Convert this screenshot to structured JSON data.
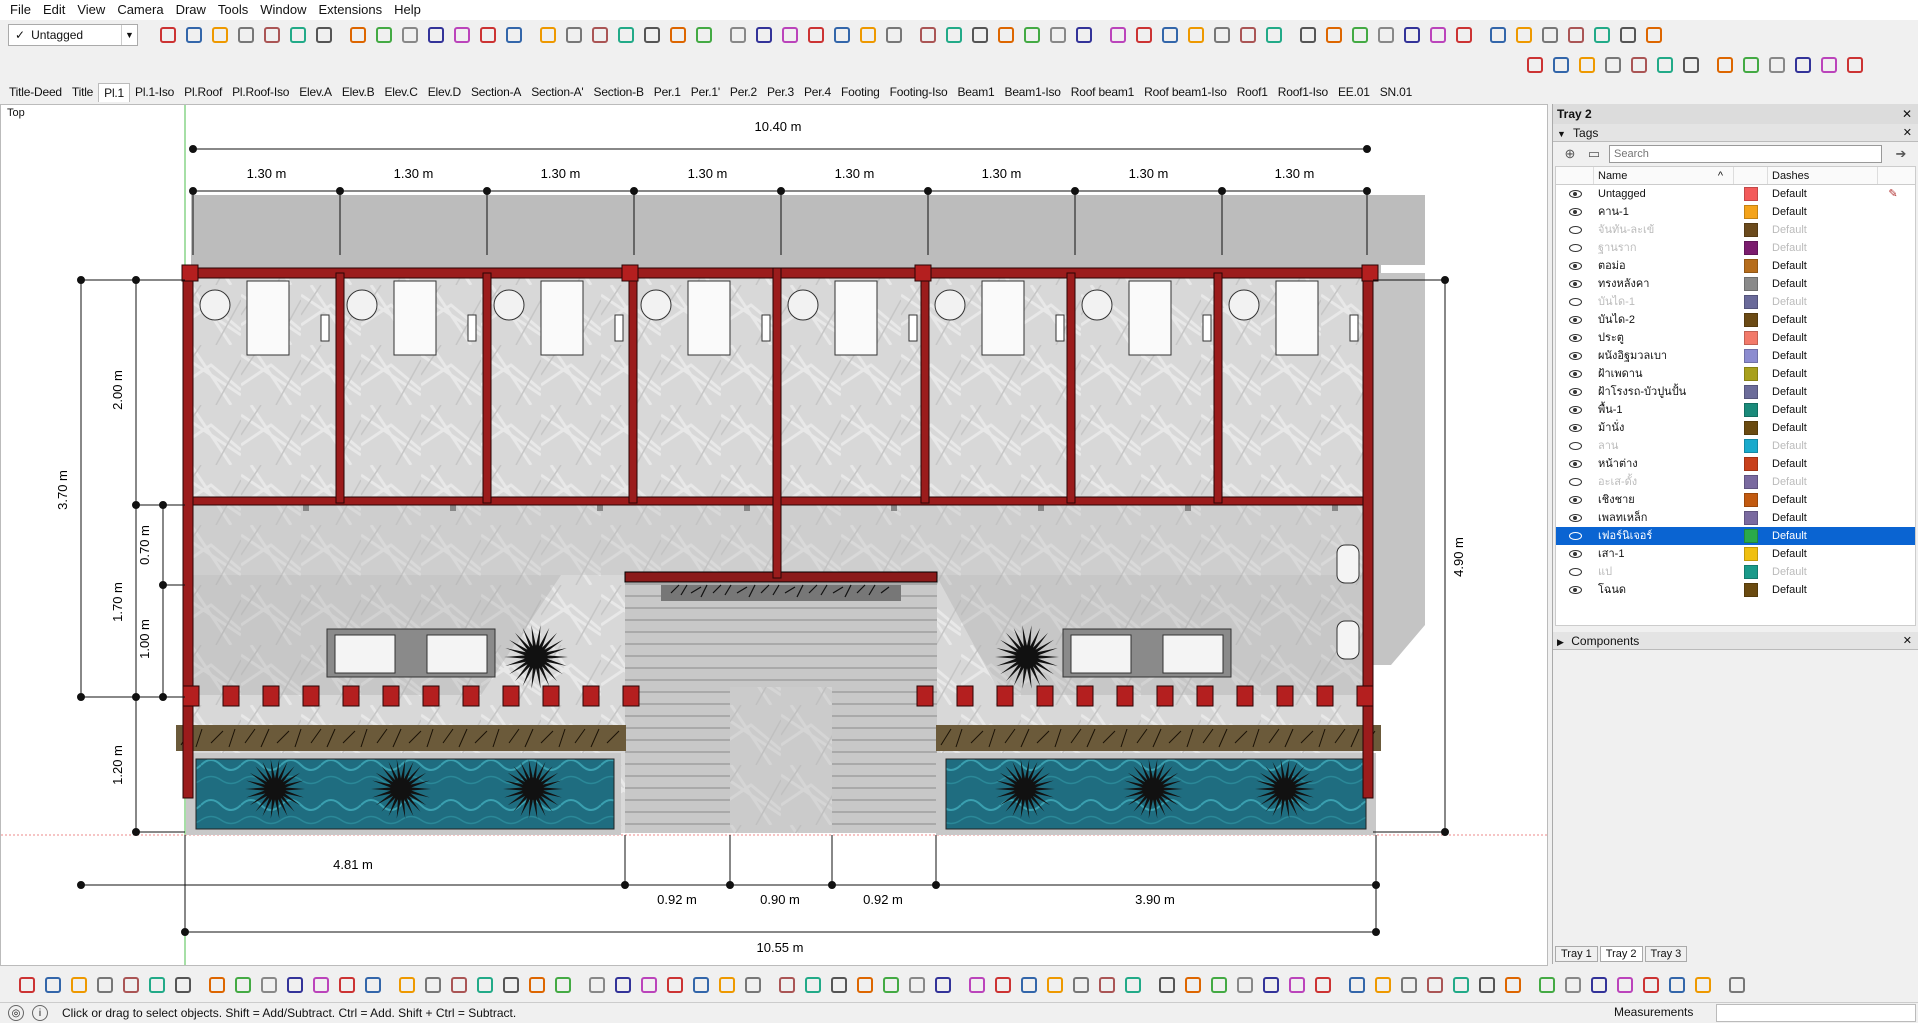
{
  "menu": [
    "File",
    "Edit",
    "View",
    "Camera",
    "Draw",
    "Tools",
    "Window",
    "Extensions",
    "Help"
  ],
  "tag_selector": {
    "check": "✓",
    "value": "Untagged"
  },
  "scene_tabs": {
    "active_index": 2,
    "items": [
      "Title-Deed",
      "Title",
      "Pl.1",
      "Pl.1-Iso",
      "Pl.Roof",
      "Pl.Roof-Iso",
      "Elev.A",
      "Elev.B",
      "Elev.C",
      "Elev.D",
      "Section-A",
      "Section-A'",
      "Section-B",
      "Per.1",
      "Per.1'",
      "Per.2",
      "Per.3",
      "Per.4",
      "Footing",
      "Footing-Iso",
      "Beam1",
      "Beam1-Iso",
      "Roof beam1",
      "Roof beam1-Iso",
      "Roof1",
      "Roof1-Iso",
      "EE.01",
      "SN.01"
    ]
  },
  "viewport": {
    "view_label": "Top",
    "dimensions": {
      "top_total": "10.40 m",
      "bay": "1.30 m",
      "left_total": "3.70 m",
      "left_2": "2.00 m",
      "left_07": "0.70 m",
      "left_17": "1.70 m",
      "left_10": "1.00 m",
      "left_12": "1.20 m",
      "right_total": "4.90 m",
      "bottom_481": "4.81 m",
      "bottom_092a": "0.92 m",
      "bottom_090": "0.90 m",
      "bottom_092b": "0.92 m",
      "bottom_390": "3.90 m",
      "bottom_total": "10.55 m"
    }
  },
  "tray": {
    "title": "Tray 2",
    "tags_panel": "Tags",
    "search_placeholder": "Search",
    "col_name": "Name",
    "col_dashes": "Dashes",
    "rows": [
      {
        "name": "Untagged",
        "color": "#f35a5a",
        "dashes": "Default",
        "visible": true,
        "selected": false,
        "edit": true
      },
      {
        "name": "คาน-1",
        "color": "#f4a31a",
        "dashes": "Default",
        "visible": true,
        "selected": false
      },
      {
        "name": "จันทัน-ละเข้",
        "color": "#6b4a1c",
        "dashes": "Default",
        "visible": false,
        "selected": false
      },
      {
        "name": "ฐานราก",
        "color": "#7b1c6e",
        "dashes": "Default",
        "visible": false,
        "selected": false
      },
      {
        "name": "ตอม่อ",
        "color": "#b66d1c",
        "dashes": "Default",
        "visible": true,
        "selected": false
      },
      {
        "name": "ทรงหลังคา",
        "color": "#8a8a8a",
        "dashes": "Default",
        "visible": true,
        "selected": false
      },
      {
        "name": "บันได-1",
        "color": "#6a6a9a",
        "dashes": "Default",
        "visible": false,
        "selected": false
      },
      {
        "name": "บันได-2",
        "color": "#6b4a14",
        "dashes": "Default",
        "visible": true,
        "selected": false
      },
      {
        "name": "ประตู",
        "color": "#f27a6a",
        "dashes": "Default",
        "visible": true,
        "selected": false
      },
      {
        "name": "ผนังอิฐมวลเบา",
        "color": "#8c8cd0",
        "dashes": "Default",
        "visible": true,
        "selected": false
      },
      {
        "name": "ฝ้าเพดาน",
        "color": "#a8a01c",
        "dashes": "Default",
        "visible": true,
        "selected": false
      },
      {
        "name": "ฝ้าโรงรถ-บัวปูนปั้น",
        "color": "#6c6c9a",
        "dashes": "Default",
        "visible": true,
        "selected": false
      },
      {
        "name": "พื้น-1",
        "color": "#1a8a7a",
        "dashes": "Default",
        "visible": true,
        "selected": false
      },
      {
        "name": "ม้านั่ง",
        "color": "#6a4a10",
        "dashes": "Default",
        "visible": true,
        "selected": false
      },
      {
        "name": "ลาน",
        "color": "#1aaacc",
        "dashes": "Default",
        "visible": false,
        "selected": false
      },
      {
        "name": "หน้าต่าง",
        "color": "#c8401c",
        "dashes": "Default",
        "visible": true,
        "selected": false
      },
      {
        "name": "อะเส-ดั้ง",
        "color": "#7a6aa0",
        "dashes": "Default",
        "visible": false,
        "selected": false
      },
      {
        "name": "เชิงชาย",
        "color": "#c25a10",
        "dashes": "Default",
        "visible": true,
        "selected": false
      },
      {
        "name": "เพลทเหล็ก",
        "color": "#7a6aa0",
        "dashes": "Default",
        "visible": true,
        "selected": false
      },
      {
        "name": "เฟอร์นิเจอร์",
        "color": "#2aaa4a",
        "dashes": "Default",
        "visible": false,
        "selected": true
      },
      {
        "name": "เสา-1",
        "color": "#f0c010",
        "dashes": "Default",
        "visible": true,
        "selected": false
      },
      {
        "name": "แป",
        "color": "#1a9a8a",
        "dashes": "Default",
        "visible": false,
        "selected": false
      },
      {
        "name": "โฉนด",
        "color": "#6a4a10",
        "dashes": "Default",
        "visible": true,
        "selected": false
      }
    ],
    "components_panel": "Components",
    "tabs": [
      "Tray 1",
      "Tray 2",
      "Tray 3"
    ],
    "active_tab": 1
  },
  "status": {
    "message": "Click or drag to select objects. Shift = Add/Subtract. Ctrl = Add. Shift + Ctrl = Subtract.",
    "measurements_label": "Measurements"
  }
}
